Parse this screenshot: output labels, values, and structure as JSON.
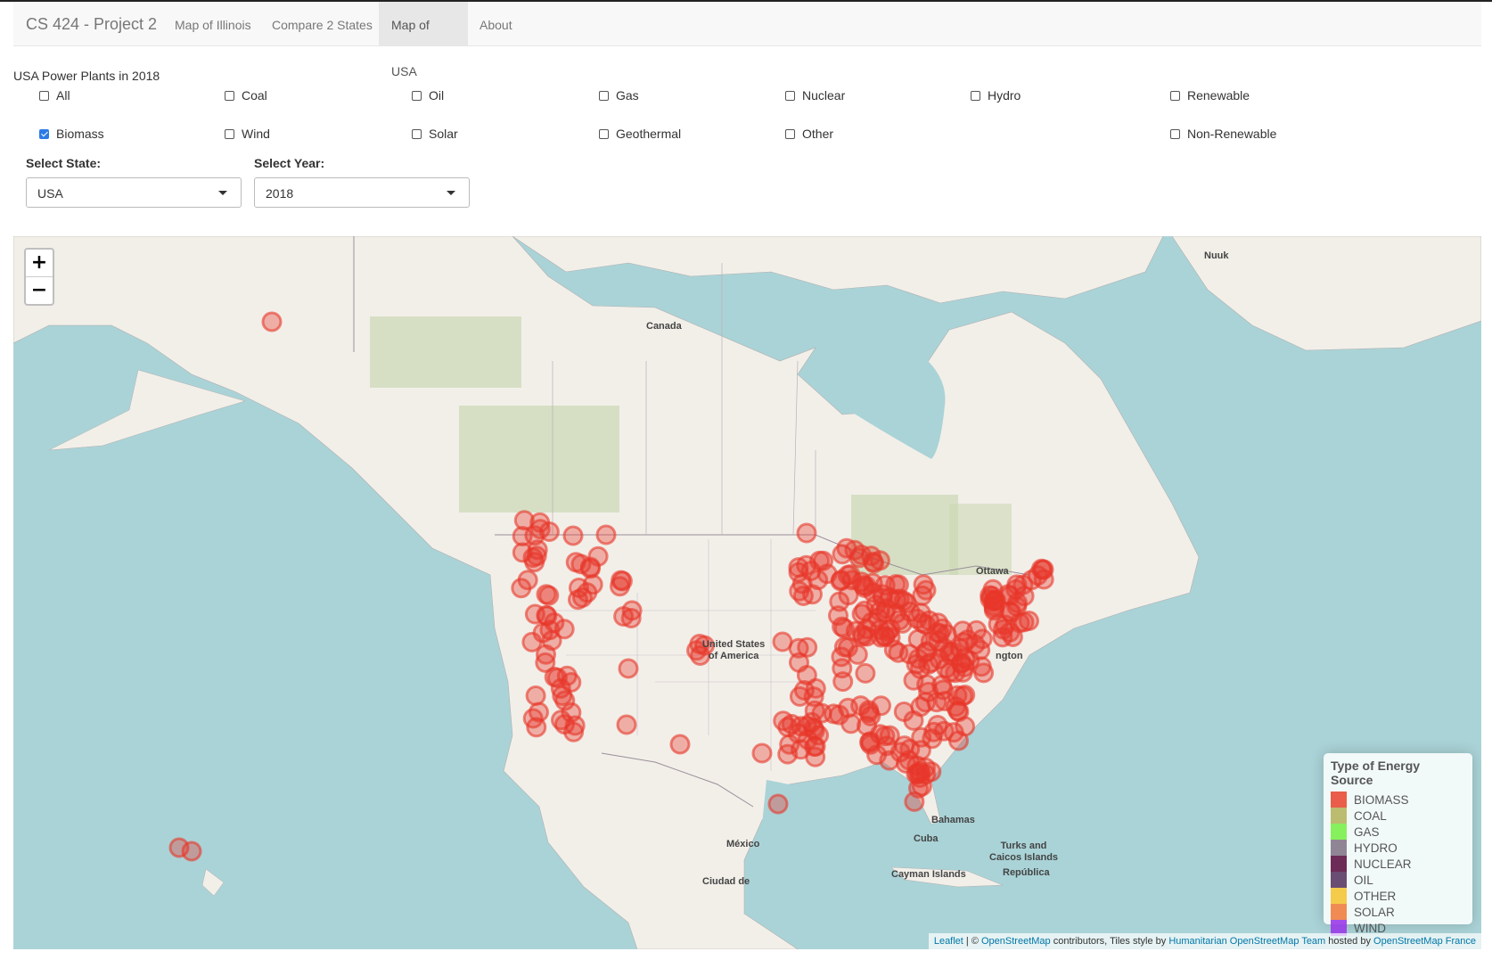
{
  "navbar": {
    "brand": "CS 424 - Project 2",
    "items": [
      "Map of Illinois",
      "Compare 2 States",
      "Map of USA",
      "About"
    ],
    "active": "Map of USA"
  },
  "page": {
    "heading": "USA Power Plants in 2018"
  },
  "filters": {
    "row1": [
      {
        "label": "All",
        "checked": false
      },
      {
        "label": "Coal",
        "checked": false
      },
      {
        "label": "Oil",
        "checked": false
      },
      {
        "label": "Gas",
        "checked": false
      },
      {
        "label": "Nuclear",
        "checked": false
      },
      {
        "label": "Hydro",
        "checked": false
      },
      {
        "label": "Renewable",
        "checked": false
      }
    ],
    "row2": [
      {
        "label": "Biomass",
        "checked": true
      },
      {
        "label": "Wind",
        "checked": false
      },
      {
        "label": "Solar",
        "checked": false
      },
      {
        "label": "Geothermal",
        "checked": false
      },
      {
        "label": "Other",
        "checked": false
      },
      {
        "label": "Non-Renewable",
        "checked": false
      }
    ]
  },
  "state_select": {
    "label": "Select State:",
    "value": "USA"
  },
  "year_select": {
    "label": "Select Year:",
    "value": "2018"
  },
  "map": {
    "zoom_in": "+",
    "zoom_out": "−",
    "labels": {
      "canada": "Canada",
      "nuuk": "Nuuk",
      "ottawa": "Ottawa",
      "usa": "United States\nof America",
      "washington": "ngton",
      "mexico": "México",
      "ciudad": "Ciudad de",
      "bahamas": "Bahamas",
      "cuba": "Cuba",
      "turks": "Turks and\nCaicos Islands",
      "cayman": "Cayman Islands",
      "republica": "República"
    },
    "marker_color": "#e8372a",
    "attribution": {
      "leaflet": "Leaflet",
      "sep": " | © ",
      "osm": "OpenStreetMap",
      "mid": " contributors, Tiles style by ",
      "hot": "Humanitarian OpenStreetMap Team",
      "hosted": " hosted by ",
      "osmfr": "OpenStreetMap France"
    }
  },
  "legend": {
    "title": "Type of Energy Source",
    "items": [
      {
        "label": "BIOMASS",
        "color": "#e84b36"
      },
      {
        "label": "COAL",
        "color": "#b5b55f"
      },
      {
        "label": "GAS",
        "color": "#7aef4b"
      },
      {
        "label": "HYDRO",
        "color": "#85788a"
      },
      {
        "label": "NUCLEAR",
        "color": "#5e1446"
      },
      {
        "label": "OIL",
        "color": "#5a3a63"
      },
      {
        "label": "OTHER",
        "color": "#f5c538"
      },
      {
        "label": "SOLAR",
        "color": "#ef8040"
      },
      {
        "label": "WIND",
        "color": "#9a3be8"
      }
    ]
  }
}
